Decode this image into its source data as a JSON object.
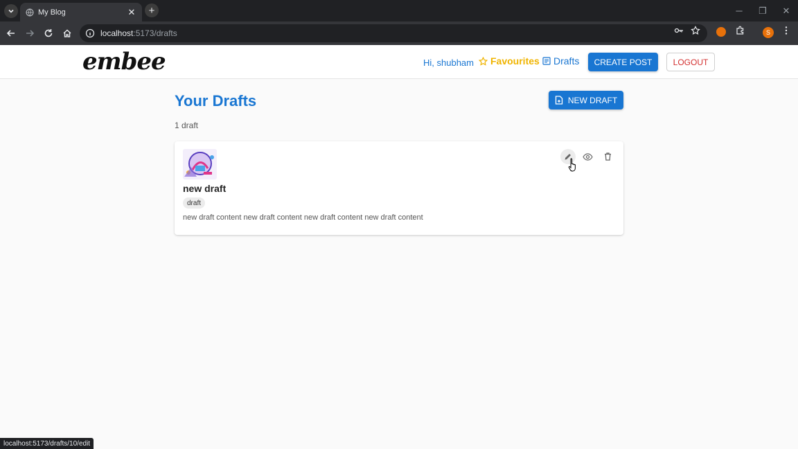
{
  "browser": {
    "tab_title": "My Blog",
    "url_host": "localhost",
    "url_path": ":5173/drafts"
  },
  "header": {
    "logo": "embee",
    "greeting": "Hi, shubham",
    "favourites_label": "Favourites",
    "drafts_label": "Drafts",
    "create_post_label": "CREATE POST",
    "logout_label": "LOGOUT"
  },
  "main": {
    "title": "Your Drafts",
    "new_draft_label": "NEW DRAFT",
    "count": "1 draft",
    "drafts": [
      {
        "title": "new draft",
        "tag": "draft",
        "excerpt": "new draft content new draft content new draft content new draft content"
      }
    ]
  },
  "status_url": "localhost:5173/drafts/10/edit",
  "colors": {
    "primary": "#1976d2",
    "favourite": "#f0b400",
    "logout": "#d32f2f"
  }
}
